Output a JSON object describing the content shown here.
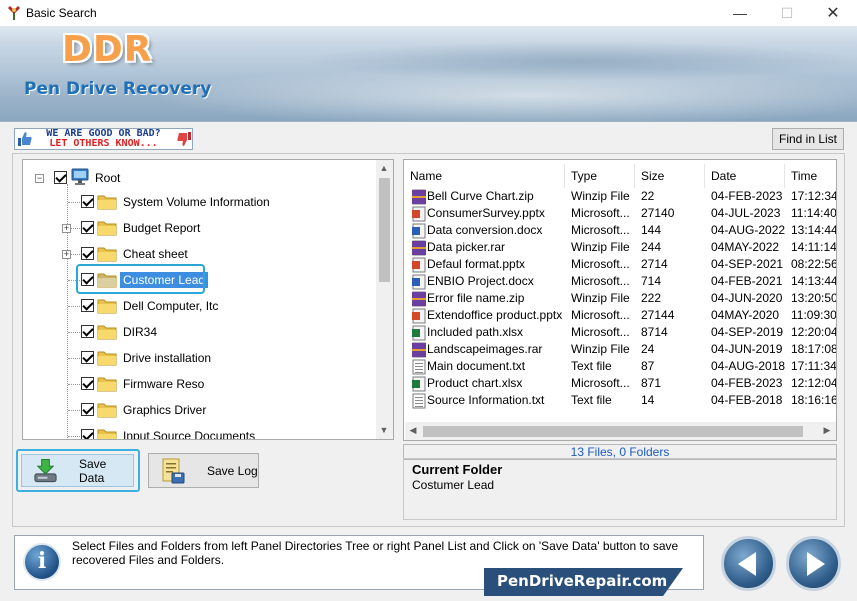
{
  "window": {
    "title": "Basic Search",
    "minimize": "—",
    "maximize": "☐",
    "close": "✕"
  },
  "banner": {
    "logo": "DDR",
    "product": "Pen Drive Recovery"
  },
  "feedback": {
    "line1": "WE ARE GOOD OR BAD?",
    "line2": "LET OTHERS KNOW..."
  },
  "toolbar": {
    "find_label": "Find in List"
  },
  "tree": {
    "root": "Root",
    "items": [
      {
        "label": "System Volume Information",
        "expandable": false
      },
      {
        "label": "Budget Report",
        "expandable": true
      },
      {
        "label": "Cheat sheet",
        "expandable": true
      },
      {
        "label": "Customer Lead",
        "expandable": false,
        "selected": true
      },
      {
        "label": "Dell Computer, Itc",
        "expandable": false
      },
      {
        "label": "DIR34",
        "expandable": false
      },
      {
        "label": "Drive installation",
        "expandable": false
      },
      {
        "label": "Firmware Reso",
        "expandable": false
      },
      {
        "label": "Graphics Driver",
        "expandable": false
      },
      {
        "label": "Input Source Documents",
        "expandable": false
      }
    ]
  },
  "list": {
    "columns": [
      "Name",
      "Type",
      "Size",
      "Date",
      "Time"
    ],
    "rows": [
      {
        "icon": "archive",
        "name": "Bell Curve Chart.zip",
        "type": "Winzip File",
        "size": "22",
        "date": "04-FEB-2023",
        "time": "17:12:34"
      },
      {
        "icon": "ppt",
        "name": "ConsumerSurvey.pptx",
        "type": "Microsoft...",
        "size": "27140",
        "date": "04-JUL-2023",
        "time": "11:14:40"
      },
      {
        "icon": "word",
        "name": "Data conversion.docx",
        "type": "Microsoft...",
        "size": "144",
        "date": "04-AUG-2022",
        "time": "13:14:44"
      },
      {
        "icon": "archive",
        "name": "Data picker.rar",
        "type": "Winzip File",
        "size": "244",
        "date": "04MAY-2022",
        "time": "14:11:14"
      },
      {
        "icon": "ppt",
        "name": "Defaul format.pptx",
        "type": "Microsoft...",
        "size": "2714",
        "date": "04-SEP-2021",
        "time": "08:22:56"
      },
      {
        "icon": "word",
        "name": "ENBIO Project.docx",
        "type": "Microsoft...",
        "size": "714",
        "date": "04-FEB-2021",
        "time": "14:13:44"
      },
      {
        "icon": "archive",
        "name": "Error file name.zip",
        "type": "Winzip File",
        "size": "222",
        "date": "04-JUN-2020",
        "time": "13:20:50"
      },
      {
        "icon": "ppt",
        "name": "Extendoffice product.pptx",
        "type": "Microsoft...",
        "size": "27144",
        "date": "04MAY-2020",
        "time": "11:09:30"
      },
      {
        "icon": "excel",
        "name": "Included path.xlsx",
        "type": "Microsoft...",
        "size": "8714",
        "date": "04-SEP-2019",
        "time": "12:20:04"
      },
      {
        "icon": "archive",
        "name": "Landscapeimages.rar",
        "type": "Winzip File",
        "size": "24",
        "date": "04-JUN-2019",
        "time": "18:17:08"
      },
      {
        "icon": "text",
        "name": "Main document.txt",
        "type": "Text file",
        "size": "87",
        "date": "04-AUG-2018",
        "time": "17:11:34"
      },
      {
        "icon": "excel",
        "name": "Product chart.xlsx",
        "type": "Microsoft...",
        "size": "871",
        "date": "04-FEB-2023",
        "time": "12:12:04"
      },
      {
        "icon": "text",
        "name": "Source Information.txt",
        "type": "Text file",
        "size": "14",
        "date": "04-FEB-2018",
        "time": "18:16:16"
      }
    ]
  },
  "status": {
    "summary": "13 Files, 0 Folders"
  },
  "current_folder": {
    "title": "Current Folder",
    "value": "Costumer Lead"
  },
  "buttons": {
    "save_data": "Save Data",
    "save_log": "Save Log"
  },
  "info": {
    "text": "Select Files and Folders from left Panel Directories Tree or right Panel List and Click on 'Save Data' button to save recovered Files and Folders."
  },
  "site": {
    "label": "PenDriveRepair.com"
  }
}
